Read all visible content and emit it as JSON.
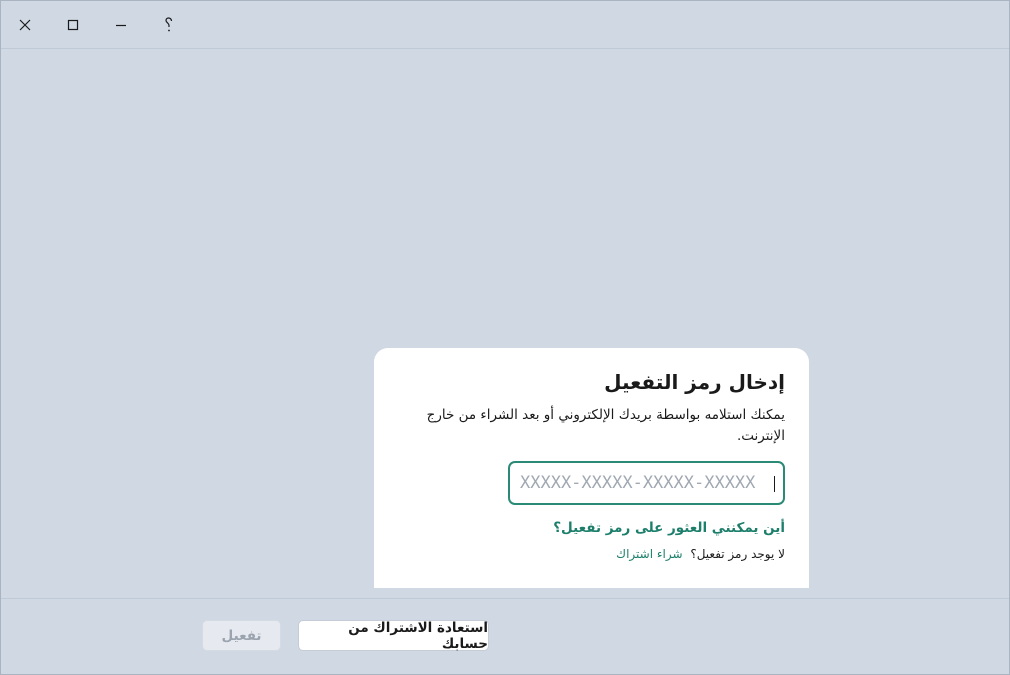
{
  "titlebar": {
    "close_icon": "close-icon",
    "maximize_icon": "maximize-icon",
    "minimize_icon": "minimize-icon",
    "help_icon": "help-icon"
  },
  "card": {
    "title": "إدخال رمز التفعيل",
    "description": "يمكنك استلامه بواسطة بريدك الإلكتروني أو بعد الشراء من خارج الإنترنت.",
    "code_input": {
      "value": "",
      "placeholder": "XXXXX-XXXXX-XXXXX-XXXXX"
    },
    "find_link": "أين يمكنني العثور على رمز تفعيل؟",
    "no_code_text": "لا يوجد رمز تفعيل؟",
    "buy_link": "شراء اشتراك"
  },
  "footer": {
    "restore_button": "استعادة الاشتراك من حسابك",
    "activate_button": "تفعيل"
  },
  "colors": {
    "background": "#cfd8e3",
    "accent": "#1d7f6b",
    "input_border": "#2a8a76",
    "disabled_text": "#9aa3ae"
  }
}
